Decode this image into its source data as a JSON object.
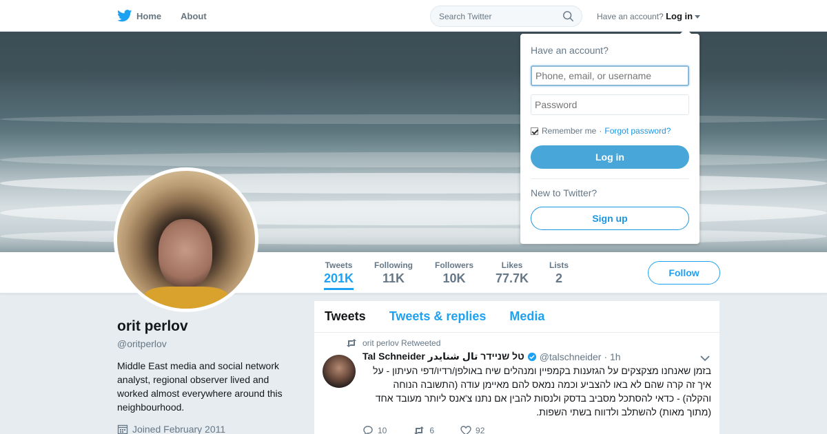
{
  "nav": {
    "home_label": "Home",
    "about_label": "About",
    "search_placeholder": "Search Twitter",
    "account_prompt": "Have an account?",
    "login_label": "Log in",
    "icons": {
      "home": "twitter-bird-icon",
      "search": "search-icon"
    }
  },
  "profile": {
    "name": "orit perlov",
    "handle": "@oritperlov",
    "bio": "Middle East media and social network analyst, regional observer lived and worked almost everywhere around this neighbourhood.",
    "joined": "Joined February 2011",
    "stats": [
      {
        "label": "Tweets",
        "value": "201K"
      },
      {
        "label": "Following",
        "value": "11K"
      },
      {
        "label": "Followers",
        "value": "10K"
      },
      {
        "label": "Likes",
        "value": "77.7K"
      },
      {
        "label": "Lists",
        "value": "2"
      }
    ],
    "follow_label": "Follow"
  },
  "timeline": {
    "tabs": [
      "Tweets",
      "Tweets & replies",
      "Media"
    ],
    "active_tab": "Tweets",
    "tweet": {
      "retweet_text": "orit perlov Retweeted",
      "author": "Tal Schneider טל שניידר تال شنايدر",
      "handle": "@talschneider",
      "time": "· 1h",
      "text": "בזמן שאנחנו מצקצקים על הגזענות בקמפיין ומנהלים שיח באולפן/רדיו/דפי העיתון - על איך זה קרה שהם לא באו להצביע וכמה נמאס להם מאיימן עודה (התשובה הנוחה והקלה) - כדאי להסתכל מסביב בדסק ולנסות להבין אם נתנו צ'אנס ליותר מעובד אחד (מתוך מאות) להשתלב ולדווח בשתי השפות.",
      "replies": "10",
      "retweets": "6",
      "likes": "92"
    }
  },
  "login_dropdown": {
    "title": "Have an account?",
    "username_placeholder": "Phone, email, or username",
    "password_placeholder": "Password",
    "remember_label": "Remember me",
    "separator": "·",
    "forgot_label": "Forgot password?",
    "login_button": "Log in",
    "new_prompt": "New to Twitter?",
    "signup_button": "Sign up"
  },
  "colors": {
    "accent": "#1da1f2",
    "login_button": "#48a7d8",
    "link": "#1b95e0"
  }
}
